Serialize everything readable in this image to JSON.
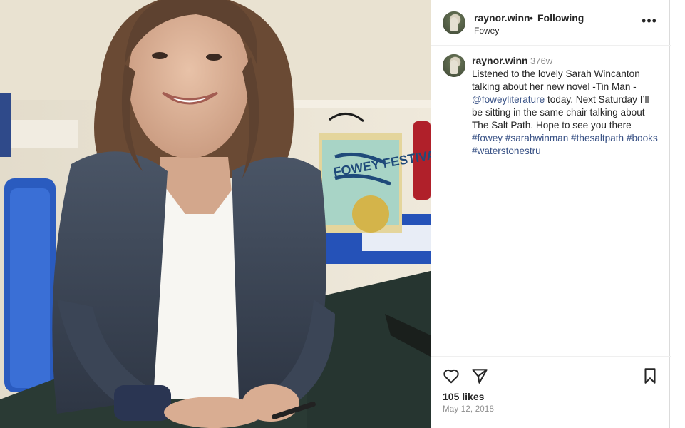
{
  "post": {
    "username": "raynor.winn",
    "separator": "•",
    "follow_status": "Following",
    "location": "Fowey",
    "more_icon": "more-horizontal-icon"
  },
  "caption": {
    "username": "raynor.winn",
    "time_ago": "376w",
    "segments": [
      {
        "text": "Listened to the lovely Sarah Wincanton talking about her new novel -Tin Man - ",
        "link": false
      },
      {
        "text": "@foweyliterature",
        "link": true
      },
      {
        "text": " today. Next Saturday I’ll be sitting in the same chair talking about The Salt Path. Hope to see you there ",
        "link": false
      },
      {
        "text": "#fowey",
        "link": true
      },
      {
        "text": " ",
        "link": false
      },
      {
        "text": "#sarahwinman",
        "link": true
      },
      {
        "text": " ",
        "link": false
      },
      {
        "text": "#thesaltpath",
        "link": true
      },
      {
        "text": " ",
        "link": false
      },
      {
        "text": "#books",
        "link": true
      },
      {
        "text": " ",
        "link": false
      },
      {
        "text": "#waterstonestru",
        "link": true
      }
    ]
  },
  "actions": {
    "like_icon": "heart-icon",
    "share_icon": "paper-plane-icon",
    "save_icon": "bookmark-icon",
    "likes": "105 likes",
    "date": "May 12, 2018"
  },
  "colors": {
    "link": "#385185",
    "muted": "#8e8e8e",
    "text": "#262626",
    "border": "#efefef"
  },
  "photo": {
    "subject": "photo-of-woman-at-table",
    "bag_text": "FOWEY FESTIVAL"
  }
}
